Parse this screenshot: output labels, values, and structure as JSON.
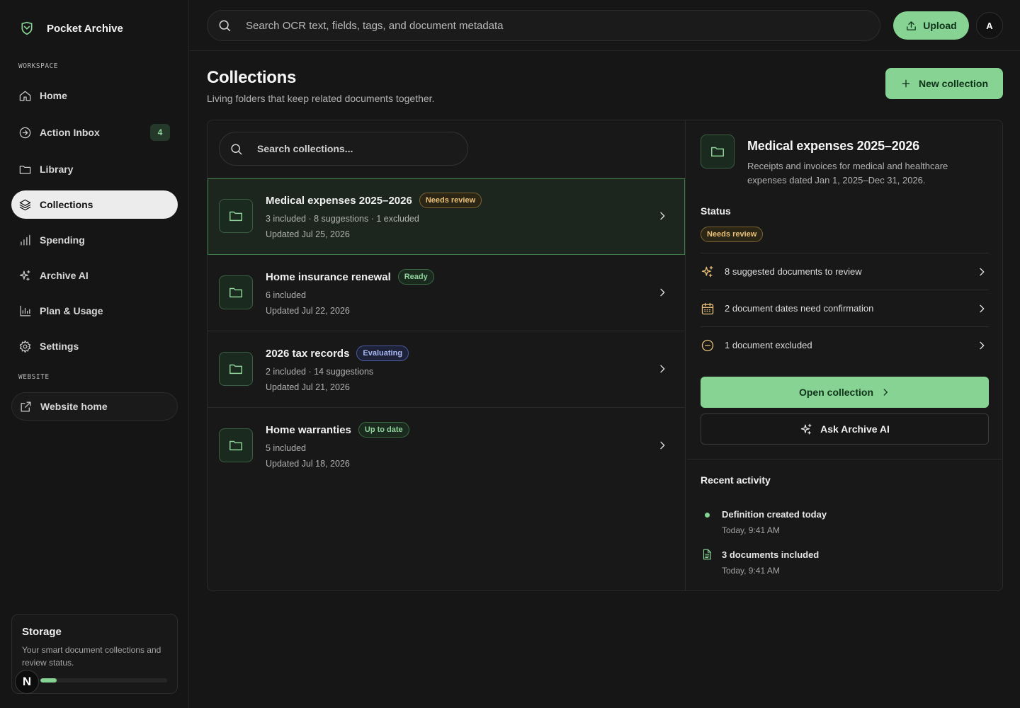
{
  "brand": {
    "name": "Pocket Archive",
    "icon": "shield-leaf-logo",
    "accent": "#86d393"
  },
  "sidebar": {
    "workspace_label": "WORKSPACE",
    "website_label": "WEBSITE",
    "items": [
      {
        "label": "Home",
        "icon": "home-icon"
      },
      {
        "label": "Action Inbox",
        "icon": "circle-arrow-icon",
        "badge": "4"
      },
      {
        "label": "Library",
        "icon": "folder-icon"
      },
      {
        "label": "Collections",
        "icon": "layers-icon",
        "active": true
      },
      {
        "label": "Spending",
        "icon": "bar-chart-icon"
      },
      {
        "label": "Archive AI",
        "icon": "sparkles-icon"
      },
      {
        "label": "Plan & Usage",
        "icon": "chart-icon"
      },
      {
        "label": "Settings",
        "icon": "gear-icon"
      }
    ],
    "website_home": {
      "label": "Website home",
      "icon": "external-link-icon"
    },
    "storage": {
      "title": "Storage",
      "description": "Your smart document collections and review status.",
      "used_fraction": 0.13,
      "badge": "N"
    }
  },
  "topbar": {
    "search_placeholder": "Search OCR text, fields, tags, and document metadata",
    "upload_label": "Upload",
    "avatar_initial": "A"
  },
  "page": {
    "title": "Collections",
    "subtitle": "Living folders that keep related documents together.",
    "new_collection_label": "New collection"
  },
  "list": {
    "search_placeholder": "Search collections...",
    "collections": [
      {
        "name": "Medical expenses 2025–2026",
        "status": "Needs review",
        "status_kind": "review",
        "meta": "3 included · 8 suggestions · 1 excluded",
        "updated": "Updated Jul 25, 2026",
        "selected": true
      },
      {
        "name": "Home insurance renewal",
        "status": "Ready",
        "status_kind": "ready",
        "meta": "6 included",
        "updated": "Updated Jul 22, 2026",
        "selected": false
      },
      {
        "name": "2026 tax records",
        "status": "Evaluating",
        "status_kind": "eval",
        "meta": "2 included · 14 suggestions",
        "updated": "Updated Jul 21, 2026",
        "selected": false
      },
      {
        "name": "Home warranties",
        "status": "Up to date",
        "status_kind": "uptodate",
        "meta": "5 included",
        "updated": "Updated Jul 18, 2026",
        "selected": false
      }
    ]
  },
  "detail": {
    "title": "Medical expenses 2025–2026",
    "description": "Receipts and invoices for medical and healthcare expenses dated Jan 1, 2025–Dec 31, 2026.",
    "status_label": "Status",
    "status": "Needs review",
    "actions": [
      {
        "label": "8 suggested documents to review",
        "icon": "sparkles-icon"
      },
      {
        "label": "2 document dates need confirmation",
        "icon": "calendar-icon"
      },
      {
        "label": "1 document excluded",
        "icon": "minus-circle-icon"
      }
    ],
    "open_label": "Open collection",
    "ask_label": "Ask Archive AI",
    "activity_title": "Recent activity",
    "activity": [
      {
        "text": "Definition created today",
        "time": "Today, 9:41 AM",
        "icon": "dot"
      },
      {
        "text": "3 documents included",
        "time": "Today, 9:41 AM",
        "icon": "document-icon"
      }
    ]
  }
}
